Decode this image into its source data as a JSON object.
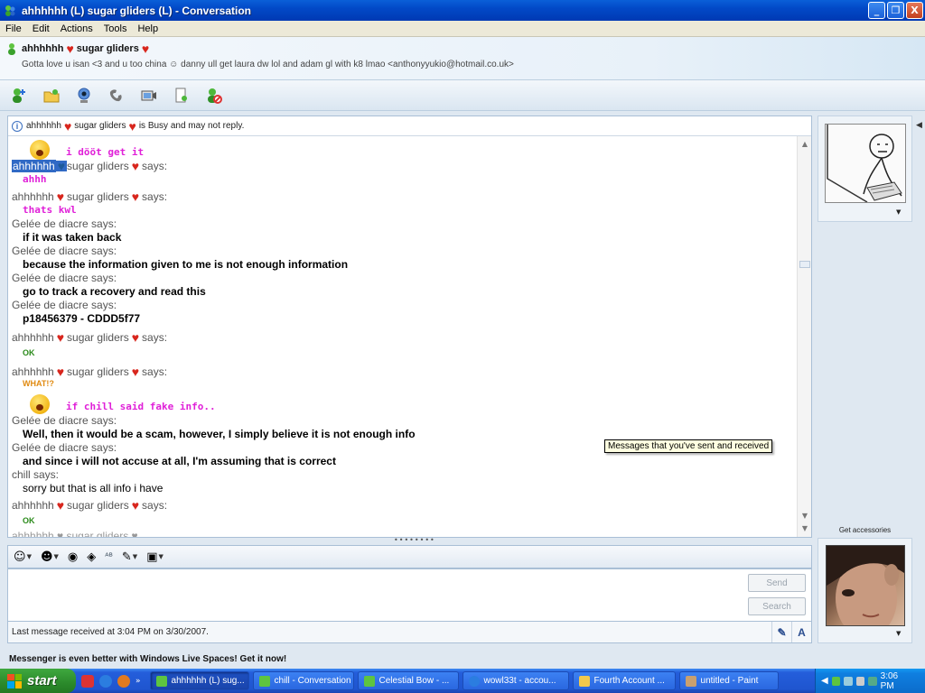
{
  "window": {
    "title": "ahhhhhh (L) sugar gliders (L) - Conversation",
    "minimize": "_",
    "maximize": "❐",
    "close": "X"
  },
  "menu": [
    "File",
    "Edit",
    "Actions",
    "Tools",
    "Help"
  ],
  "contact": {
    "name_part1": "ahhhhhh",
    "name_part2": "sugar gliders",
    "personal_message": "Gotta love u isan <3 and u too china ☺ danny ull get laura dw lol and adam gl with k8 lmao <anthonyyukio@hotmail.co.uk>"
  },
  "toolbar_icons": [
    "invite-contact-icon",
    "send-files-icon",
    "webcam-icon",
    "call-icon",
    "video-icon",
    "activities-icon",
    "block-icon"
  ],
  "status_notice": {
    "name_part1": "ahhhhhh",
    "name_part2": "sugar gliders",
    "text": "is Busy and may not reply."
  },
  "conversation": {
    "first_pink": "i dööt get it",
    "says": "says:",
    "ahh_name1": "ahhhhhh",
    "ahh_name2": "sugar gliders",
    "gelee": "Gelée de diacre says:",
    "chill": "chill says:",
    "m1": "ahhh",
    "m2": "thats kwl",
    "m3": "if it was taken back",
    "m4": "because the information given to me is not enough information",
    "m5": "go to track a recovery and read this",
    "m6": "p18456379 -  CDDD5f77",
    "tag_ok": "OK",
    "tag_what": "WHAT!?",
    "m7": "if chill said fake info..",
    "m8": "Well, then it would be a scam, however, I simply believe it is not enough info",
    "m9": "and since i will not accuse at all, I'm assuming that is correct",
    "m10": "sorry but that is all info i have",
    "partial": "ahhhhhh ♥ sugar gliders ♥"
  },
  "tooltip": "Messages that you've sent and received",
  "compose": {
    "send": "Send",
    "search": "Search",
    "value": ""
  },
  "status_line": "Last message received at 3:04 PM on 3/30/2007.",
  "promo": "Messenger is even better with Windows Live Spaces! Get it now!",
  "side": {
    "get_accessories": "Get accessories"
  },
  "taskbar": {
    "start": "start",
    "buttons": [
      "ahhhhhh (L) sug...",
      "chill - Conversation",
      "Celestial Bow - ...",
      "wowl33t - accou...",
      "Fourth Account ...",
      "untitled - Paint"
    ],
    "clock": "3:06 PM"
  },
  "colors": {
    "pink": "#e020d8",
    "heart": "#d8261d",
    "selection": "#316ac5"
  }
}
